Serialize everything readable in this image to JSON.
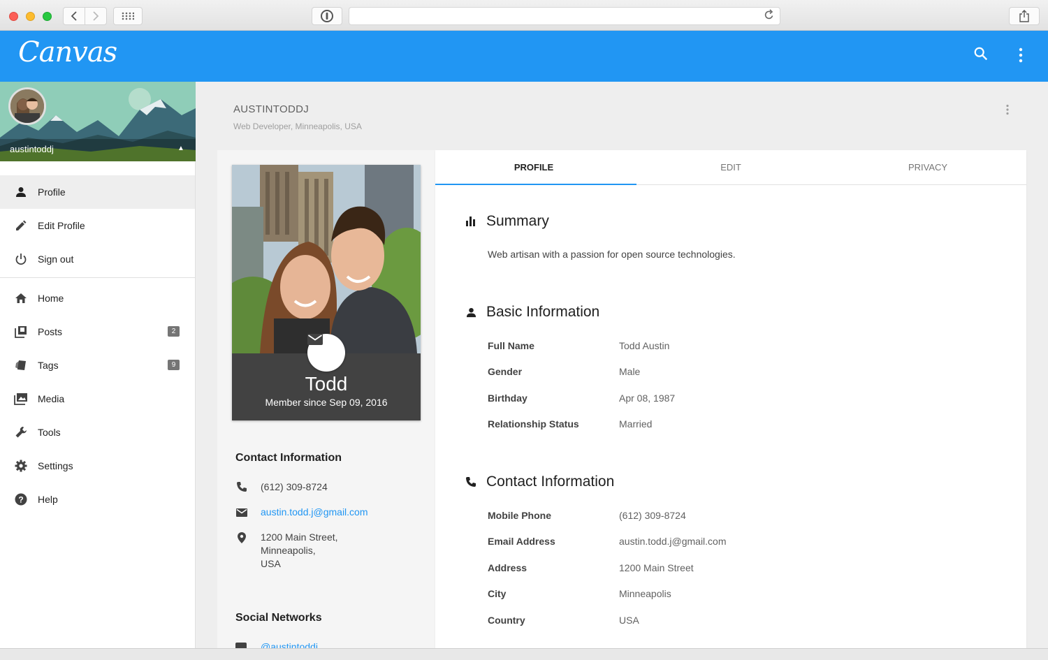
{
  "app": {
    "logo": "Canvas"
  },
  "browser": {
    "back_icon": "chevron-left-icon",
    "forward_icon": "chevron-right-icon"
  },
  "sidebar": {
    "username": "austintoddj",
    "items": [
      {
        "label": "Profile",
        "icon": "person-icon",
        "active": true
      },
      {
        "label": "Edit Profile",
        "icon": "pencil-icon"
      },
      {
        "label": "Sign out",
        "icon": "power-icon"
      }
    ],
    "nav": [
      {
        "label": "Home",
        "icon": "home-icon"
      },
      {
        "label": "Posts",
        "icon": "posts-icon",
        "badge": "2"
      },
      {
        "label": "Tags",
        "icon": "tags-icon",
        "badge": "9"
      },
      {
        "label": "Media",
        "icon": "media-icon"
      },
      {
        "label": "Tools",
        "icon": "wrench-icon"
      },
      {
        "label": "Settings",
        "icon": "gear-icon"
      },
      {
        "label": "Help",
        "icon": "help-icon"
      }
    ]
  },
  "page": {
    "title": "AUSTINTODDJ",
    "subtitle": "Web Developer, Minneapolis, USA"
  },
  "profile_card": {
    "name": "Todd",
    "member_since": "Member since Sep 09, 2016",
    "contact_title": "Contact Information",
    "phone": "(612) 309-8724",
    "email": "austin.todd.j@gmail.com",
    "address_line1": "1200 Main Street,",
    "address_line2": "Minneapolis,",
    "address_line3": "USA",
    "social_title": "Social Networks",
    "social_handle": "@austintoddj"
  },
  "tabs": [
    "PROFILE",
    "EDIT",
    "PRIVACY"
  ],
  "summary": {
    "title": "Summary",
    "text": "Web artisan with a passion for open source technologies."
  },
  "basic": {
    "title": "Basic Information",
    "rows": [
      {
        "label": "Full Name",
        "value": "Todd Austin"
      },
      {
        "label": "Gender",
        "value": "Male"
      },
      {
        "label": "Birthday",
        "value": "Apr 08, 1987"
      },
      {
        "label": "Relationship Status",
        "value": "Married"
      }
    ]
  },
  "contact": {
    "title": "Contact Information",
    "rows": [
      {
        "label": "Mobile Phone",
        "value": "(612) 309-8724"
      },
      {
        "label": "Email Address",
        "value": "austin.todd.j@gmail.com"
      },
      {
        "label": "Address",
        "value": "1200 Main Street"
      },
      {
        "label": "City",
        "value": "Minneapolis"
      },
      {
        "label": "Country",
        "value": "USA"
      }
    ]
  },
  "colors": {
    "primary": "#2196f3",
    "sidebar_active": "#eeeeee",
    "content_bg": "#eeeeee"
  }
}
